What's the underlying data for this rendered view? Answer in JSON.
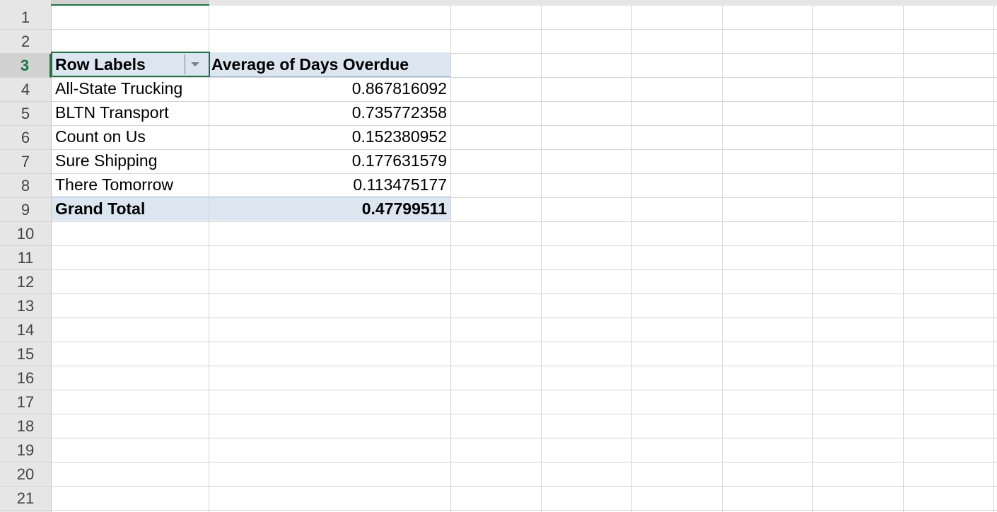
{
  "sheet": {
    "rows": [
      "1",
      "2",
      "3",
      "4",
      "5",
      "6",
      "7",
      "8",
      "9",
      "10",
      "11",
      "12",
      "13",
      "14",
      "15",
      "16",
      "17",
      "18",
      "19",
      "20",
      "21"
    ],
    "active_row": "3"
  },
  "pivot": {
    "header": {
      "row_labels": "Row Labels",
      "value_field": "Average of Days Overdue",
      "filter_icon": "filter-dropdown-icon"
    },
    "rows": [
      {
        "label": "All-State Trucking",
        "value": "0.867816092"
      },
      {
        "label": "BLTN Transport",
        "value": "0.735772358"
      },
      {
        "label": "Count on Us",
        "value": "0.152380952"
      },
      {
        "label": "Sure Shipping",
        "value": "0.177631579"
      },
      {
        "label": "There Tomorrow",
        "value": "0.113475177"
      }
    ],
    "total": {
      "label": "Grand Total",
      "value": "0.47799511"
    }
  },
  "colors": {
    "accent": "#217346",
    "pivot_band": "#dce6f1",
    "gridline": "#d4d4d4",
    "header_bg": "#e6e6e6"
  }
}
